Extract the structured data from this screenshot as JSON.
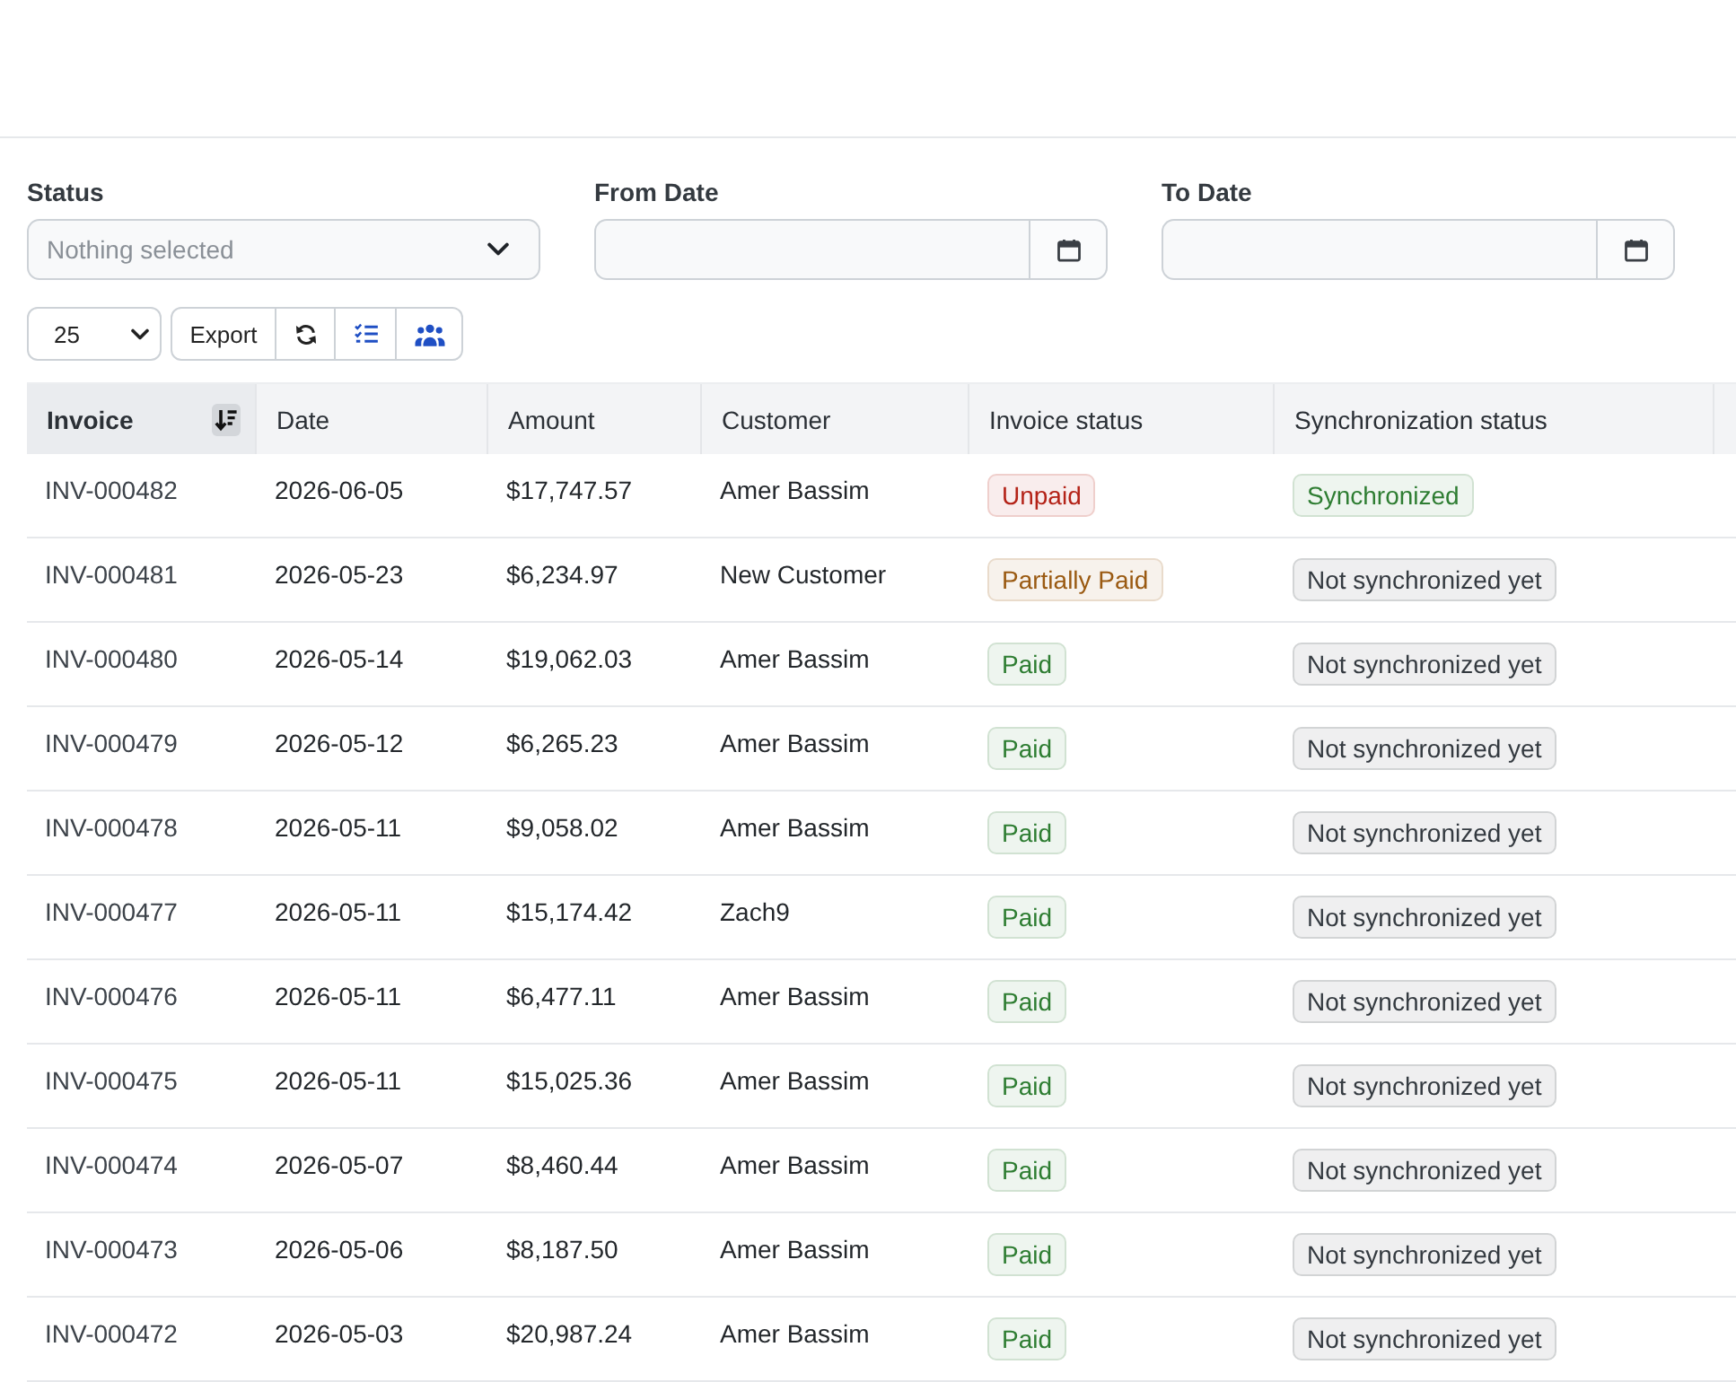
{
  "filters": {
    "status": {
      "label": "Status",
      "placeholder": "Nothing selected"
    },
    "from_date": {
      "label": "From Date"
    },
    "to_date": {
      "label": "To Date"
    }
  },
  "toolbar": {
    "page_size": "25",
    "export_label": "Export"
  },
  "table": {
    "columns": [
      {
        "label": "Invoice",
        "sorted": true
      },
      {
        "label": "Date",
        "sorted": false
      },
      {
        "label": "Amount",
        "sorted": false
      },
      {
        "label": "Customer",
        "sorted": false
      },
      {
        "label": "Invoice status",
        "sorted": false
      },
      {
        "label": "Synchronization status",
        "sorted": false
      }
    ],
    "rows": [
      {
        "invoice": "INV-000482",
        "date": "2026-06-05",
        "amount": "$17,747.57",
        "customer": "Amer Bassim",
        "invoice_status": {
          "text": "Unpaid",
          "color": "#b42318"
        },
        "sync_status": {
          "text": "Synchronized",
          "color": "#2e7d32"
        }
      },
      {
        "invoice": "INV-000481",
        "date": "2026-05-23",
        "amount": "$6,234.97",
        "customer": "New Customer",
        "invoice_status": {
          "text": "Partially Paid",
          "color": "#9a5a12"
        },
        "sync_status": {
          "text": "Not synchronized yet",
          "color": "#343a40"
        }
      },
      {
        "invoice": "INV-000480",
        "date": "2026-05-14",
        "amount": "$19,062.03",
        "customer": "Amer Bassim",
        "invoice_status": {
          "text": "Paid",
          "color": "#2e7d32"
        },
        "sync_status": {
          "text": "Not synchronized yet",
          "color": "#343a40"
        }
      },
      {
        "invoice": "INV-000479",
        "date": "2026-05-12",
        "amount": "$6,265.23",
        "customer": "Amer Bassim",
        "invoice_status": {
          "text": "Paid",
          "color": "#2e7d32"
        },
        "sync_status": {
          "text": "Not synchronized yet",
          "color": "#343a40"
        }
      },
      {
        "invoice": "INV-000478",
        "date": "2026-05-11",
        "amount": "$9,058.02",
        "customer": "Amer Bassim",
        "invoice_status": {
          "text": "Paid",
          "color": "#2e7d32"
        },
        "sync_status": {
          "text": "Not synchronized yet",
          "color": "#343a40"
        }
      },
      {
        "invoice": "INV-000477",
        "date": "2026-05-11",
        "amount": "$15,174.42",
        "customer": "Zach9",
        "invoice_status": {
          "text": "Paid",
          "color": "#2e7d32"
        },
        "sync_status": {
          "text": "Not synchronized yet",
          "color": "#343a40"
        }
      },
      {
        "invoice": "INV-000476",
        "date": "2026-05-11",
        "amount": "$6,477.11",
        "customer": "Amer Bassim",
        "invoice_status": {
          "text": "Paid",
          "color": "#2e7d32"
        },
        "sync_status": {
          "text": "Not synchronized yet",
          "color": "#343a40"
        }
      },
      {
        "invoice": "INV-000475",
        "date": "2026-05-11",
        "amount": "$15,025.36",
        "customer": "Amer Bassim",
        "invoice_status": {
          "text": "Paid",
          "color": "#2e7d32"
        },
        "sync_status": {
          "text": "Not synchronized yet",
          "color": "#343a40"
        }
      },
      {
        "invoice": "INV-000474",
        "date": "2026-05-07",
        "amount": "$8,460.44",
        "customer": "Amer Bassim",
        "invoice_status": {
          "text": "Paid",
          "color": "#2e7d32"
        },
        "sync_status": {
          "text": "Not synchronized yet",
          "color": "#343a40"
        }
      },
      {
        "invoice": "INV-000473",
        "date": "2026-05-06",
        "amount": "$8,187.50",
        "customer": "Amer Bassim",
        "invoice_status": {
          "text": "Paid",
          "color": "#2e7d32"
        },
        "sync_status": {
          "text": "Not synchronized yet",
          "color": "#343a40"
        }
      },
      {
        "invoice": "INV-000472",
        "date": "2026-05-03",
        "amount": "$20,987.24",
        "customer": "Amer Bassim",
        "invoice_status": {
          "text": "Paid",
          "color": "#2e7d32"
        },
        "sync_status": {
          "text": "Not synchronized yet",
          "color": "#343a40"
        }
      }
    ]
  }
}
